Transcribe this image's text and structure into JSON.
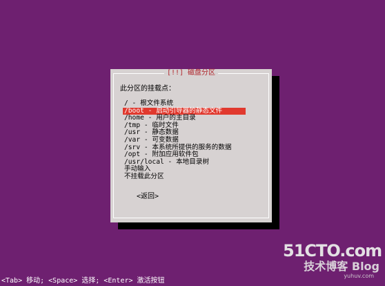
{
  "dialog": {
    "title": "[!!] 磁盘分区",
    "prompt": "此分区的挂载点：",
    "options": [
      "/ - 根文件系统",
      "/boot - 启动引导器的静态文件",
      "/home - 用户的主目录",
      "/tmp - 临时文件",
      "/usr - 静态数据",
      "/var - 可变数据",
      "/srv - 本系统所提供的服务的数据",
      "/opt - 附加应用软件包",
      "/usr/local - 本地目录树",
      "手动输入",
      "不挂载此分区"
    ],
    "selected_index": 1,
    "back_label": "<返回>"
  },
  "hint_bar": "<Tab> 移动; <Space> 选择; <Enter> 激活按钮",
  "watermark": {
    "main": "51CTO.com",
    "sub": "技术博客 Blog",
    "small": "yuhuv.com"
  },
  "colors": {
    "background": "#6e2070",
    "dialog_bg": "#d7d2d2",
    "title": "#b0252c",
    "selection": "#e1392e"
  }
}
